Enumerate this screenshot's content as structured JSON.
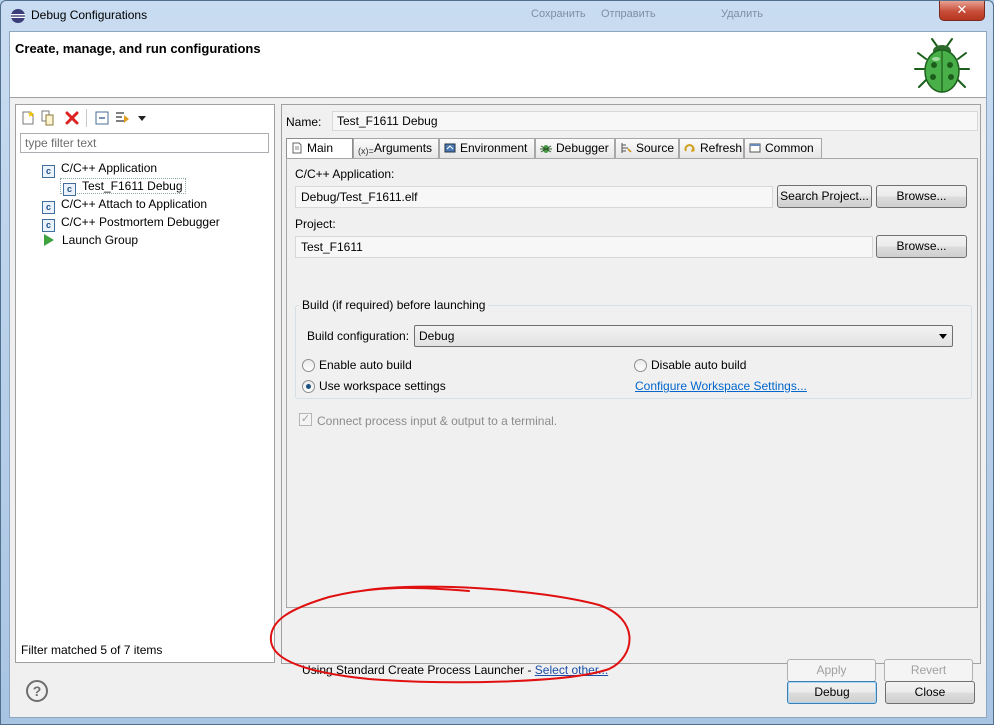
{
  "window": {
    "title": "Debug Configurations",
    "close_glyph": "✕",
    "background_hints": [
      "Сохранить",
      "Отправить",
      "Удалить"
    ]
  },
  "header": {
    "title": "Create, manage, and run configurations",
    "logo_icon": "debug-bug-icon"
  },
  "left": {
    "toolbar_icons": [
      "new-configuration-icon",
      "duplicate-icon",
      "delete-icon",
      "collapse-all-icon",
      "filter-icon",
      "view-menu-chevron-icon"
    ],
    "filter_placeholder": "type filter text",
    "tree": [
      {
        "label": "C/C++ Application",
        "icon": "c-app-icon",
        "level": 0
      },
      {
        "label": "Test_F1611 Debug",
        "icon": "c-app-icon",
        "level": 1,
        "selected": true
      },
      {
        "label": "C/C++ Attach to Application",
        "icon": "c-app-icon",
        "level": 0
      },
      {
        "label": "C/C++ Postmortem Debugger",
        "icon": "c-app-icon",
        "level": 0
      },
      {
        "label": "Launch Group",
        "icon": "launch-group-icon",
        "level": 0
      }
    ],
    "status": "Filter matched 5 of 7 items"
  },
  "right": {
    "name_label": "Name:",
    "name_value": "Test_F1611 Debug",
    "tabs": [
      {
        "label": "Main",
        "icon": "main-tab-icon",
        "active": true
      },
      {
        "label": "Arguments",
        "icon": "arguments-icon"
      },
      {
        "label": "Environment",
        "icon": "environment-icon"
      },
      {
        "label": "Debugger",
        "icon": "debugger-icon"
      },
      {
        "label": "Source",
        "icon": "source-icon"
      },
      {
        "label": "Refresh",
        "icon": "refresh-icon"
      },
      {
        "label": "Common",
        "icon": "common-icon"
      }
    ],
    "main": {
      "app_label": "C/C++ Application:",
      "app_value": "Debug/Test_F1611.elf",
      "search_project": "Search Project...",
      "browse": "Browse...",
      "project_label": "Project:",
      "project_value": "Test_F1611",
      "build_group": "Build (if required) before launching",
      "build_config_label": "Build configuration:",
      "build_config_value": "Debug",
      "enable_auto_build": "Enable auto build",
      "disable_auto_build": "Disable auto build",
      "use_workspace": "Use workspace settings",
      "configure_link": "Configure Workspace Settings...",
      "connect_terminal": "Connect process input & output to a terminal.",
      "selected_radio": "use_workspace"
    },
    "launcher_text": "Using Standard Create Process Launcher - ",
    "select_other": "Select other...",
    "apply": "Apply",
    "revert": "Revert"
  },
  "footer": {
    "help_glyph": "?",
    "debug": "Debug",
    "close": "Close"
  },
  "colors": {
    "annotation": "#e01010",
    "link": "#0066cc",
    "bug_green": "#2e9a2e"
  }
}
